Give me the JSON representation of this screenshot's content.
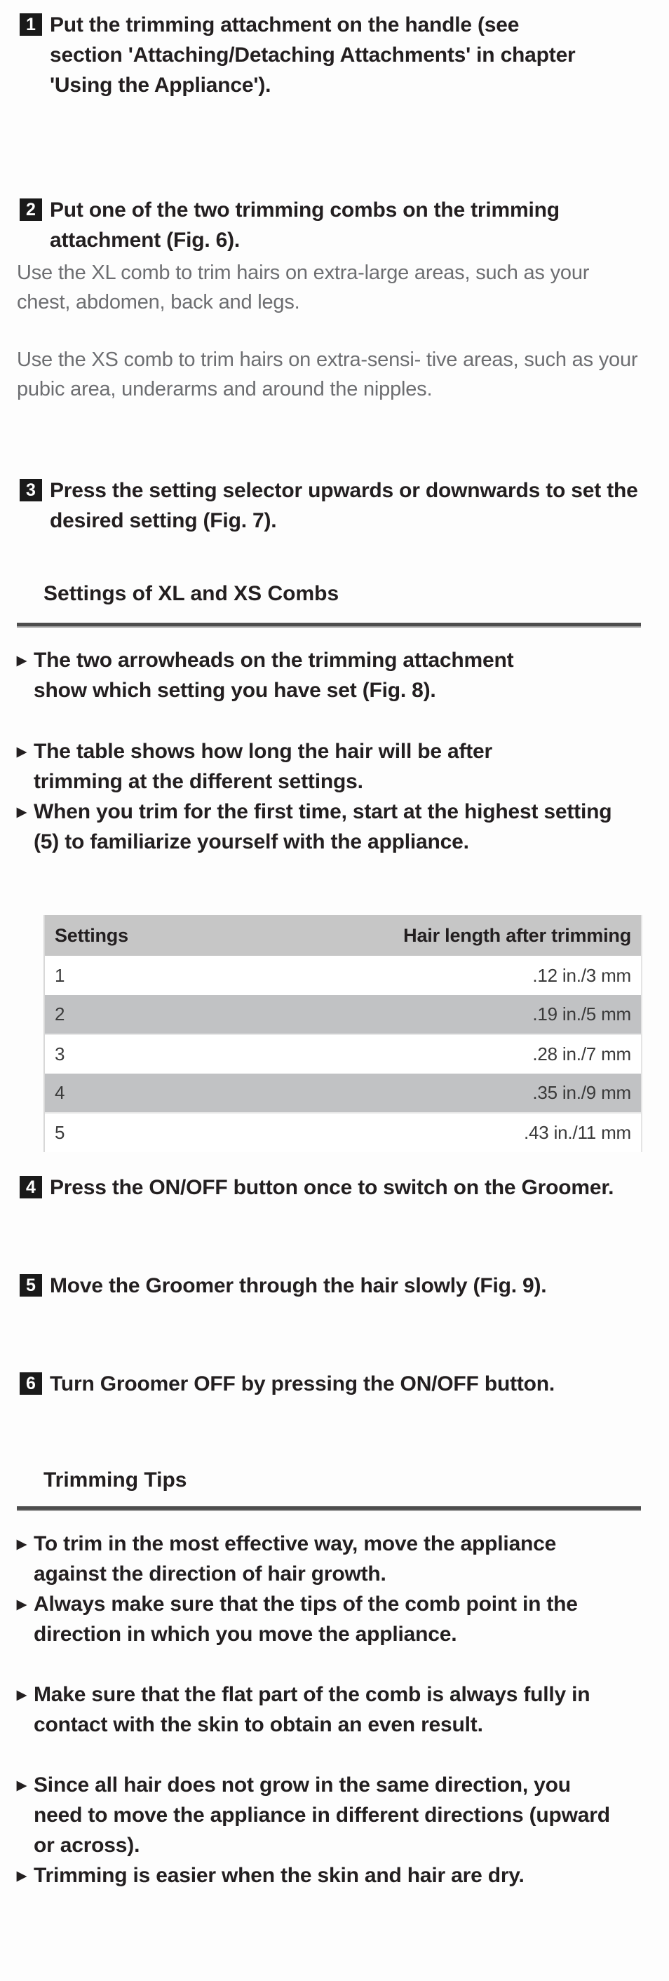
{
  "document": {
    "type": "appliance-instruction-manual-page",
    "language": "en"
  },
  "steps": [
    {
      "number": "1",
      "text": "Put the trimming attachment on the handle (see section 'Attaching/Detaching Attachments' in chapter 'Using the Appliance')."
    },
    {
      "number": "2",
      "text": "Put one of the two trimming combs on the trimming attachment (Fig. 6)."
    },
    {
      "number": "3",
      "text": "Press the setting selector upwards or downwards to set the desired setting (Fig. 7)."
    },
    {
      "number": "4",
      "text": "Press the ON/OFF button once to switch on the Groomer."
    },
    {
      "number": "5",
      "text": "Move the Groomer through the hair slowly (Fig. 9)."
    },
    {
      "number": "6",
      "text": "Turn Groomer OFF by pressing the ON/OFF button."
    }
  ],
  "dash_notes": [
    {
      "dash": "–",
      "text": "Use the XL comb to trim hairs on extra-large areas, such as your chest, abdomen, back and legs."
    },
    {
      "dash": "–",
      "text": "Use the XS comb to trim hairs on extra-sensi- tive areas, such as your pubic area, underarms and around the nipples."
    }
  ],
  "sections": [
    {
      "id": "settings",
      "heading": "Settings of XL and XS Combs",
      "bullet_glyph": "▸",
      "bullets": [
        "The two arrowheads on the trimming attachment show which setting you have set (Fig. 8).",
        "The table shows how long the hair will be after trimming at the different settings.",
        "When you trim for the first time, start at the highest setting (5) to familiarize yourself with the appliance."
      ]
    },
    {
      "id": "trimming-tips",
      "heading": "Trimming Tips",
      "bullet_glyph": "▸",
      "bullets": [
        "To trim in the most effective way, move the appliance against the direction of hair growth.",
        "Always make sure that the tips of the comb point in the direction in which you move the appliance.",
        "Make sure that the flat part of the comb is always fully in contact with the skin to obtain an even result.",
        "Since all hair does not grow in the same direction, you need to move the appliance in different directions (upward or across).",
        "Trimming is easier when the skin and hair are dry."
      ]
    }
  ],
  "settings_table": {
    "columns": [
      "Settings",
      "Hair length after trimming"
    ],
    "rows": [
      {
        "setting": "1",
        "length": ".12 in./3 mm",
        "shaded": false
      },
      {
        "setting": "2",
        "length": ".19 in./5 mm",
        "shaded": true
      },
      {
        "setting": "3",
        "length": ".28 in./7 mm",
        "shaded": false
      },
      {
        "setting": "4",
        "length": ".35 in./9 mm",
        "shaded": true
      },
      {
        "setting": "5",
        "length": ".43 in./11 mm",
        "shaded": false
      }
    ]
  },
  "colors": {
    "text_primary": "#231f20",
    "text_secondary": "#6d6e71",
    "marker_background": "#1a1a1a",
    "marker_text": "#ffffff",
    "table_header_background": "#c6c6c6",
    "table_shaded_row": "#c1c2c4",
    "rule": "#4d4d4d",
    "page_background": "#ffffff"
  }
}
